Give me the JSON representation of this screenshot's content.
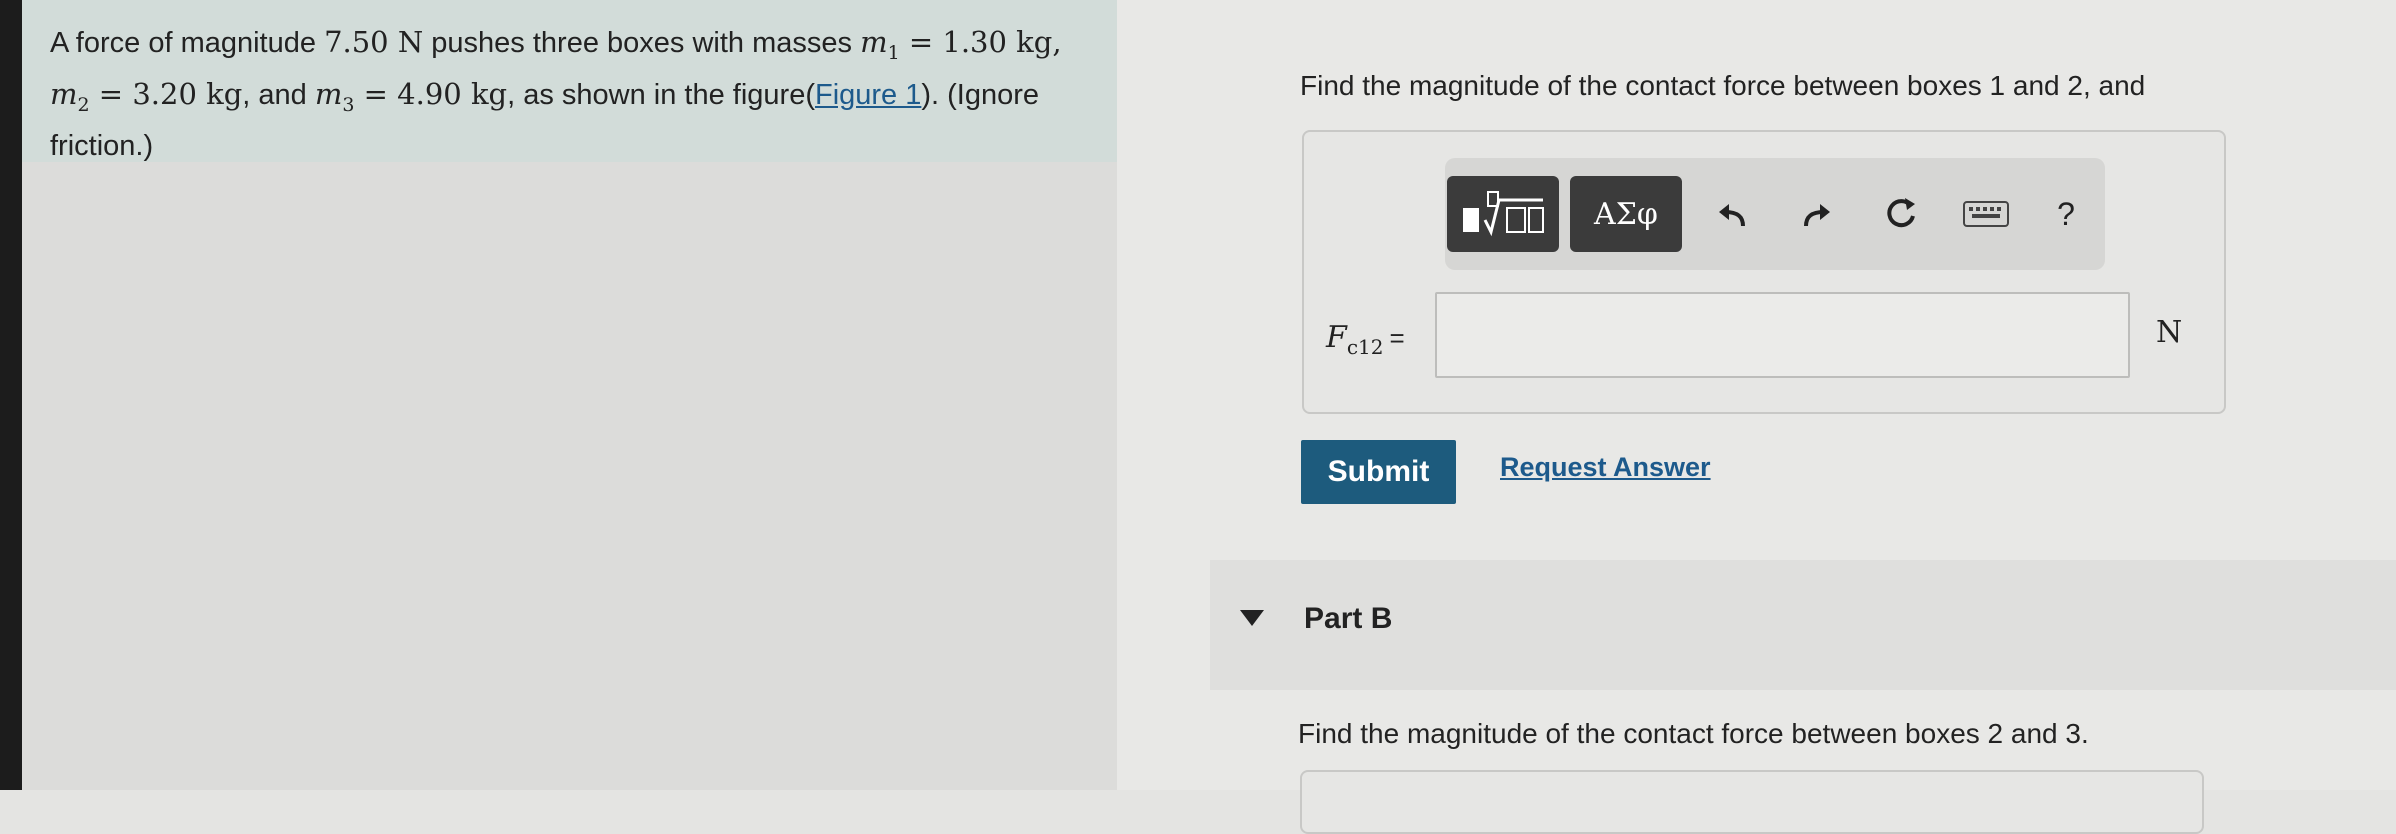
{
  "problem": {
    "t1": "A force of magnitude ",
    "force": "7.50",
    "force_unit": " N",
    "t2": " pushes three boxes with masses ",
    "m1_var": "m",
    "m1_sub": "1",
    "m1_val": " = 1.30 kg,",
    "m2_var": "m",
    "m2_sub": "2",
    "m2_val": " = 3.20 kg",
    "t3": ", and ",
    "m3_var": "m",
    "m3_sub": "3",
    "m3_val": " = 4.90 kg",
    "t4": ", as shown in the figure(",
    "figure_link": "Figure 1",
    "t5": "). (Ignore friction.)"
  },
  "part_a": {
    "question": "Find the magnitude of the contact force between boxes 1 and 2, and",
    "toolbar": {
      "templates_icon": "template-sqrt-icon",
      "symbols_label": "ΑΣφ",
      "undo_icon": "undo-icon",
      "redo_icon": "redo-icon",
      "reset_icon": "reset-icon",
      "keyboard_icon": "keyboard-icon",
      "help_label": "?"
    },
    "var": "F",
    "var_sub": "c12",
    "eq": "=",
    "input_value": "",
    "unit": "N",
    "submit_label": "Submit",
    "request_label": "Request Answer"
  },
  "part_b": {
    "label": "Part B",
    "question": "Find the magnitude of the contact force between boxes 2 and 3."
  }
}
